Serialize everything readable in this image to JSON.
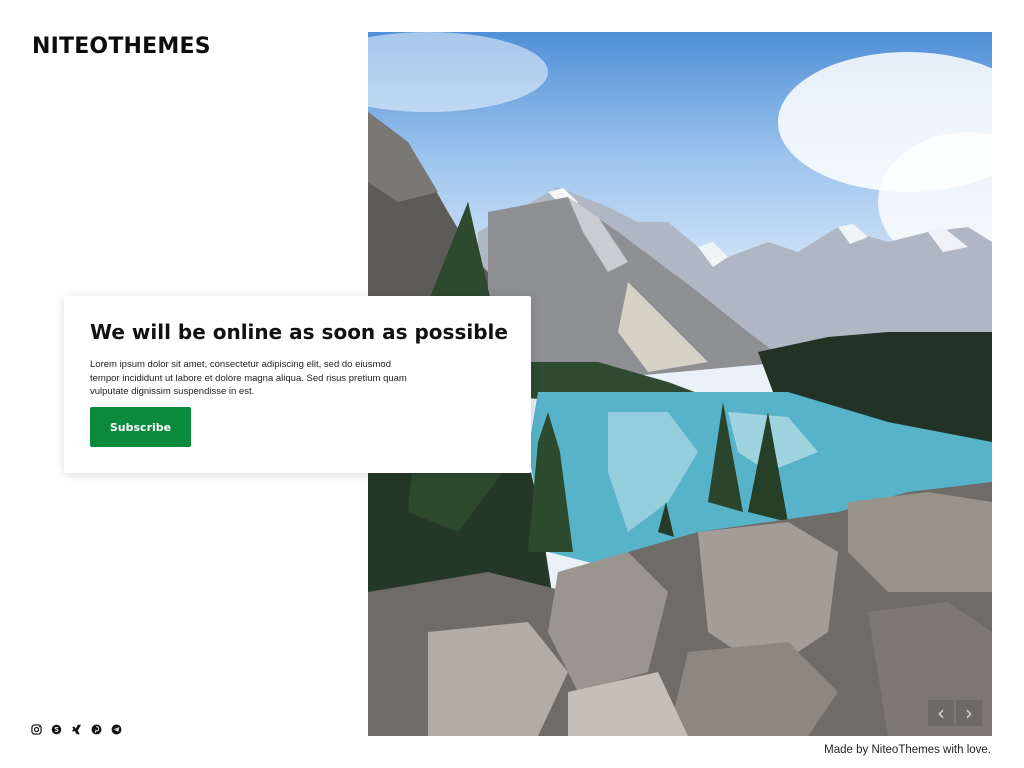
{
  "brand": {
    "logo_text": "NITEOTHEMES"
  },
  "card": {
    "heading": "We will be online as soon as possible",
    "body": "Lorem ipsum dolor sit amet, consectetur adipiscing elit, sed do eiusmod tempor incididunt ut labore et dolore magna aliqua. Sed risus pretium quam vulputate dignissim suspendisse in est.",
    "button_label": "Subscribe"
  },
  "slider": {
    "prev_icon": "chevron-left-icon",
    "next_icon": "chevron-right-icon",
    "prev_glyph": "‹",
    "next_glyph": "›"
  },
  "social": [
    "instagram-icon",
    "skype-icon",
    "xing-icon",
    "pinterest-icon",
    "telegram-icon"
  ],
  "footer": {
    "credit": "Made by NiteoThemes with love."
  },
  "colors": {
    "accent": "#0b8a3d",
    "text": "#111111",
    "background": "#ffffff"
  }
}
